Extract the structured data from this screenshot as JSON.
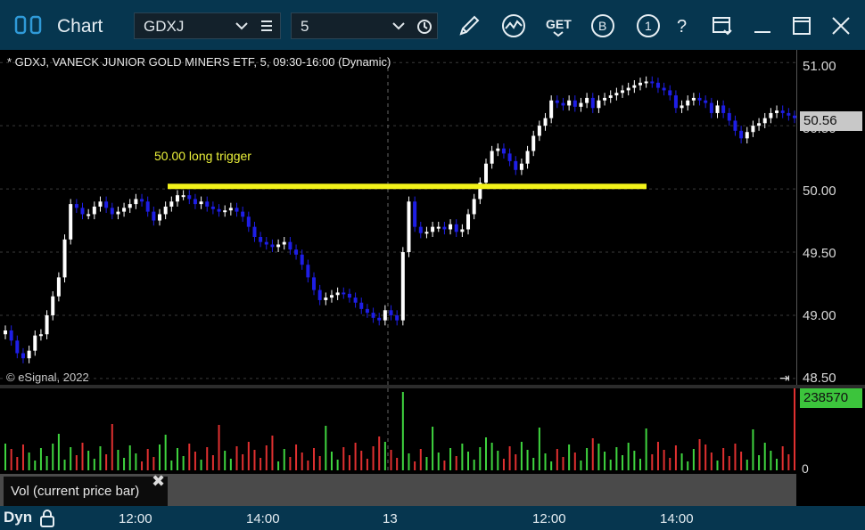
{
  "window": {
    "title": "Chart",
    "symbol": "GDXJ",
    "interval": "5",
    "toolbar_icons": [
      "draw-pencil-icon",
      "study-icon",
      "get-icon",
      "broker-icon",
      "info-icon",
      "help-icon",
      "template-icon",
      "minimize-icon",
      "maximize-icon",
      "close-icon"
    ]
  },
  "chart": {
    "title": "* GDXJ, VANECK JUNIOR GOLD MINERS ETF, 5, 09:30-16:00 (Dynamic)",
    "copyright": "© eSignal, 2022",
    "annotation": "50.00 long trigger",
    "last_price": "50.56",
    "y_ticks": [
      "51.00",
      "50.50",
      "50.00",
      "49.50",
      "49.00",
      "48.50"
    ]
  },
  "volume": {
    "label": "Vol (current price bar)",
    "last_value": "238570",
    "zero_label": "0"
  },
  "bottom": {
    "mode": "Dyn",
    "x_ticks": [
      "12:00",
      "14:00",
      "13",
      "12:00",
      "14:00"
    ]
  },
  "colors": {
    "up": "#ffffff",
    "down": "#1e1ee6",
    "trigger": "#f2f21a",
    "vol_up": "#3fd43f",
    "vol_down": "#e03030",
    "frame": "#06364f"
  },
  "chart_data": {
    "type": "candlestick",
    "title": "* GDXJ, VANECK JUNIOR GOLD MINERS ETF, 5, 09:30-16:00 (Dynamic)",
    "ylim": [
      48.45,
      51.1
    ],
    "y_ticks": [
      51.0,
      50.5,
      50.0,
      49.5,
      49.0,
      48.5
    ],
    "x_ticks": [
      "12:00",
      "14:00",
      "13",
      "12:00",
      "14:00"
    ],
    "horizontal_line": {
      "value": 50.02,
      "label": "50.00 long trigger"
    },
    "last_price": 50.56,
    "closes": [
      48.88,
      48.8,
      48.7,
      48.66,
      48.72,
      48.84,
      48.85,
      49.0,
      49.15,
      49.3,
      49.6,
      49.88,
      49.85,
      49.8,
      49.8,
      49.86,
      49.9,
      49.85,
      49.8,
      49.82,
      49.85,
      49.88,
      49.92,
      49.9,
      49.82,
      49.75,
      49.8,
      49.86,
      49.9,
      49.95,
      49.95,
      49.92,
      49.88,
      49.9,
      49.86,
      49.84,
      49.82,
      49.83,
      49.85,
      49.82,
      49.78,
      49.7,
      49.62,
      49.58,
      49.56,
      49.54,
      49.56,
      49.58,
      49.52,
      49.48,
      49.4,
      49.3,
      49.2,
      49.12,
      49.14,
      49.16,
      49.18,
      49.17,
      49.14,
      49.1,
      49.05,
      49.02,
      48.98,
      48.96,
      49.04,
      49.0,
      48.96,
      49.5,
      49.9,
      49.7,
      49.65,
      49.66,
      49.7,
      49.7,
      49.68,
      49.72,
      49.66,
      49.68,
      49.8,
      49.92,
      50.05,
      50.2,
      50.3,
      50.32,
      50.28,
      50.22,
      50.15,
      50.2,
      50.3,
      50.42,
      50.5,
      50.56,
      50.7,
      50.68,
      50.66,
      50.7,
      50.65,
      50.68,
      50.72,
      50.64,
      50.7,
      50.72,
      50.74,
      50.76,
      50.78,
      50.8,
      50.82,
      50.84,
      50.85,
      50.84,
      50.8,
      50.78,
      50.74,
      50.64,
      50.66,
      50.7,
      50.72,
      50.7,
      50.68,
      50.6,
      50.66,
      50.6,
      50.54,
      50.46,
      50.4,
      50.45,
      50.5,
      50.52,
      50.56,
      50.6,
      50.62,
      50.6,
      50.58,
      50.56
    ],
    "volume": {
      "label": "Vol (current price bar)",
      "last": 238570,
      "zero_label": "0"
    }
  }
}
